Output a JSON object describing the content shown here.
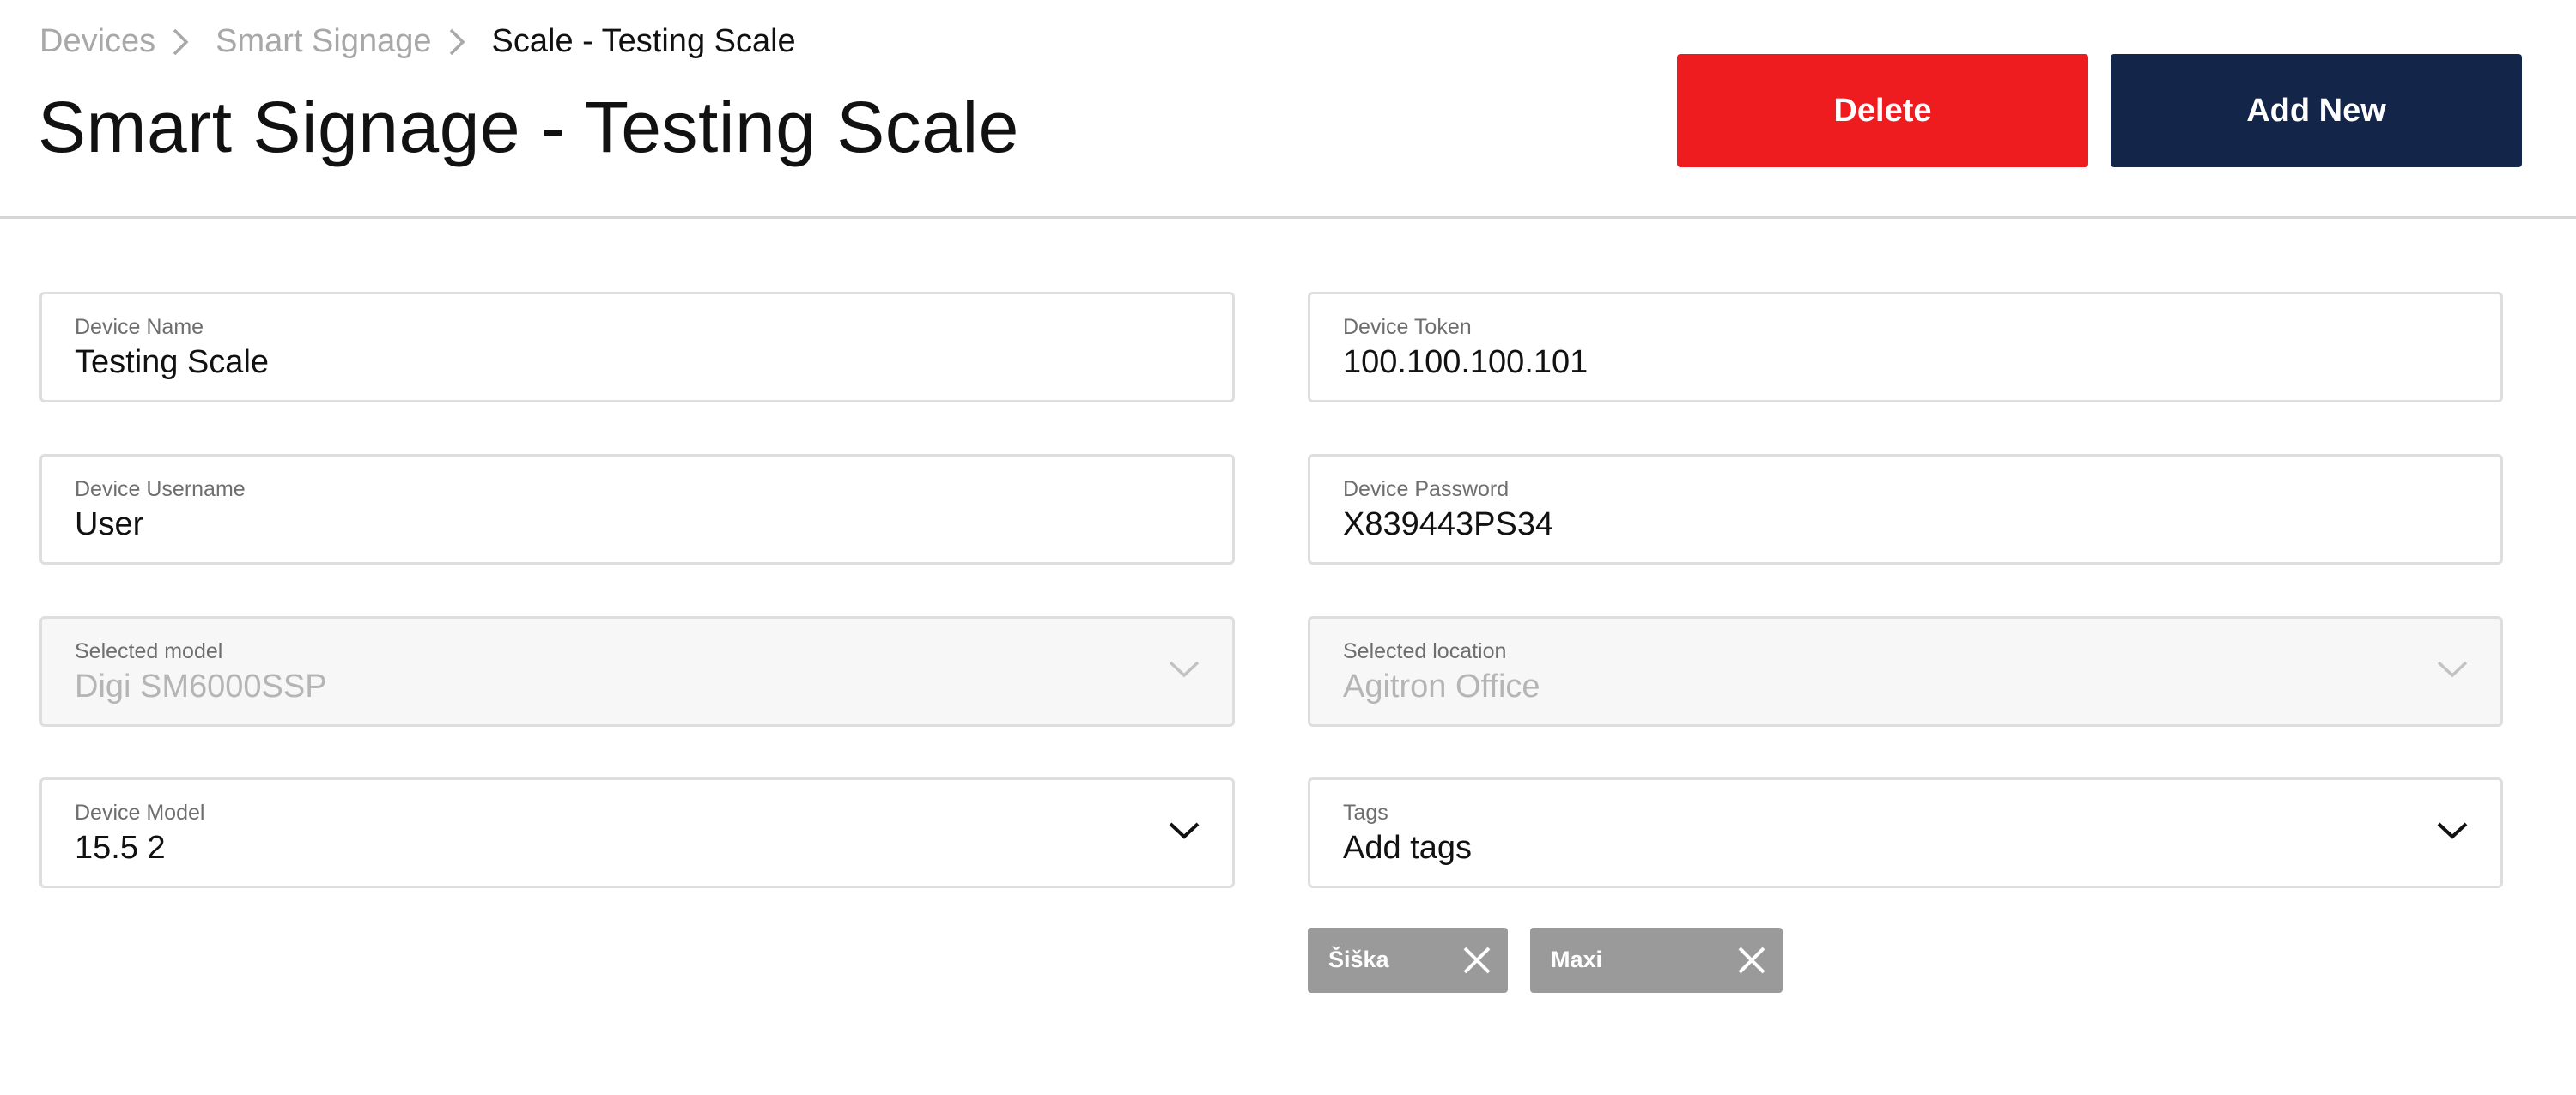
{
  "breadcrumb": {
    "items": [
      "Devices",
      "Smart Signage",
      "Scale - Testing Scale"
    ]
  },
  "header": {
    "title": "Smart Signage - Testing Scale",
    "delete_label": "Delete",
    "add_new_label": "Add New"
  },
  "colors": {
    "delete": "#ef1c1f",
    "add_new": "#14254a",
    "tag": "#9a9a9a"
  },
  "form": {
    "device_name": {
      "label": "Device Name",
      "value": "Testing Scale"
    },
    "device_token": {
      "label": "Device Token",
      "value": "100.100.100.101"
    },
    "device_username": {
      "label": "Device Username",
      "value": "User"
    },
    "device_password": {
      "label": "Device Password",
      "value": "X839443PS34"
    },
    "selected_model": {
      "label": "Selected model",
      "value": "Digi SM6000SSP",
      "disabled": true
    },
    "selected_location": {
      "label": "Selected location",
      "value": "Agitron Office",
      "disabled": true
    },
    "device_model": {
      "label": "Device Model",
      "value": "15.5 2"
    },
    "tags": {
      "label": "Tags",
      "value": "Add tags"
    }
  },
  "tags": [
    {
      "label": "Šiška",
      "remove_icon": "close-icon"
    },
    {
      "label": "Maxi",
      "remove_icon": "close-icon"
    }
  ]
}
